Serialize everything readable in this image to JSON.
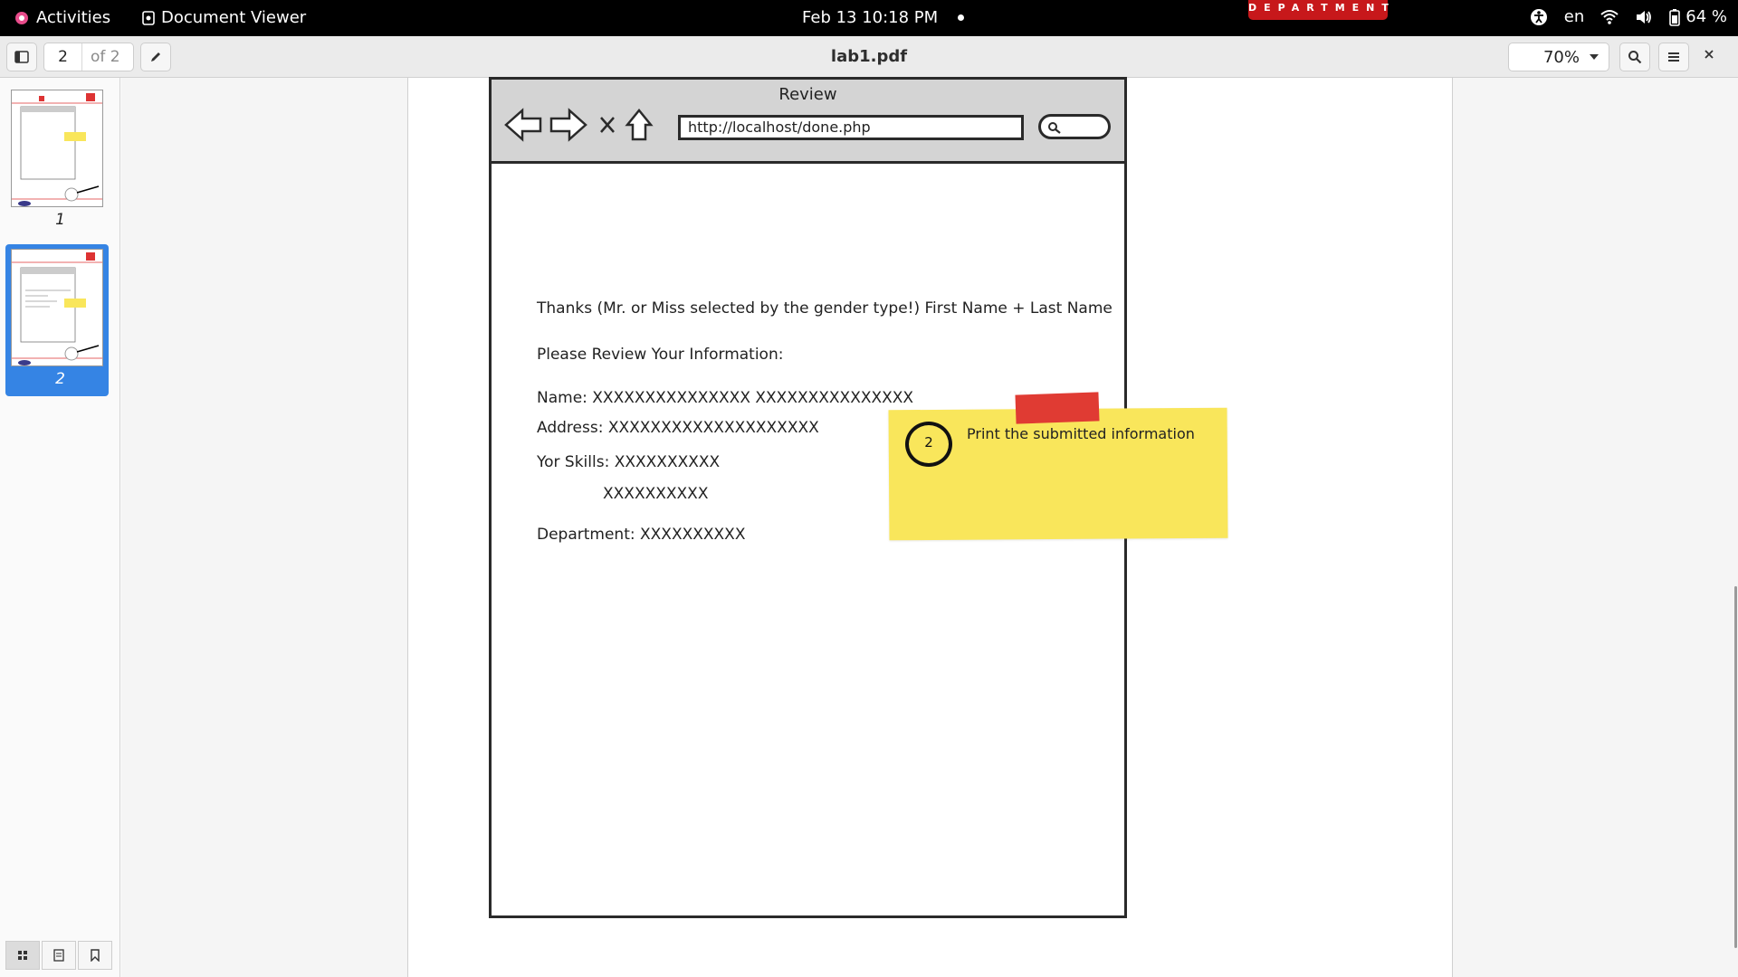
{
  "topbar": {
    "activities": "Activities",
    "app_name": "Document Viewer",
    "datetime": "Feb 13  10:18 PM",
    "language": "en",
    "battery": "64 %"
  },
  "header": {
    "page_current": "2",
    "page_total": "of 2",
    "title": "lab1.pdf",
    "zoom": "70%"
  },
  "sidebar": {
    "thumbnails": [
      {
        "label": "1"
      },
      {
        "label": "2",
        "selected": true
      }
    ]
  },
  "document": {
    "badge": "DEPARTMENT",
    "mockup": {
      "window_title": "Review",
      "url": "http://localhost/done.php",
      "lines": [
        "Thanks (Mr. or Miss selected by the gender type!) First Name + Last Name",
        "Please Review Your Information:",
        "Name: XXXXXXXXXXXXXXX XXXXXXXXXXXXXXX",
        "Address: XXXXXXXXXXXXXXXXXXXX",
        "Yor Skills: XXXXXXXXXX",
        "XXXXXXXXXX",
        "Department: XXXXXXXXXX"
      ]
    },
    "sticky_note": {
      "number": "2",
      "text": "Print the submitted information"
    }
  },
  "colors": {
    "accent": "#3584e4",
    "badge_red": "#c7181b",
    "sticky_yellow": "#f9e65b",
    "tape_red": "#e03b33"
  }
}
